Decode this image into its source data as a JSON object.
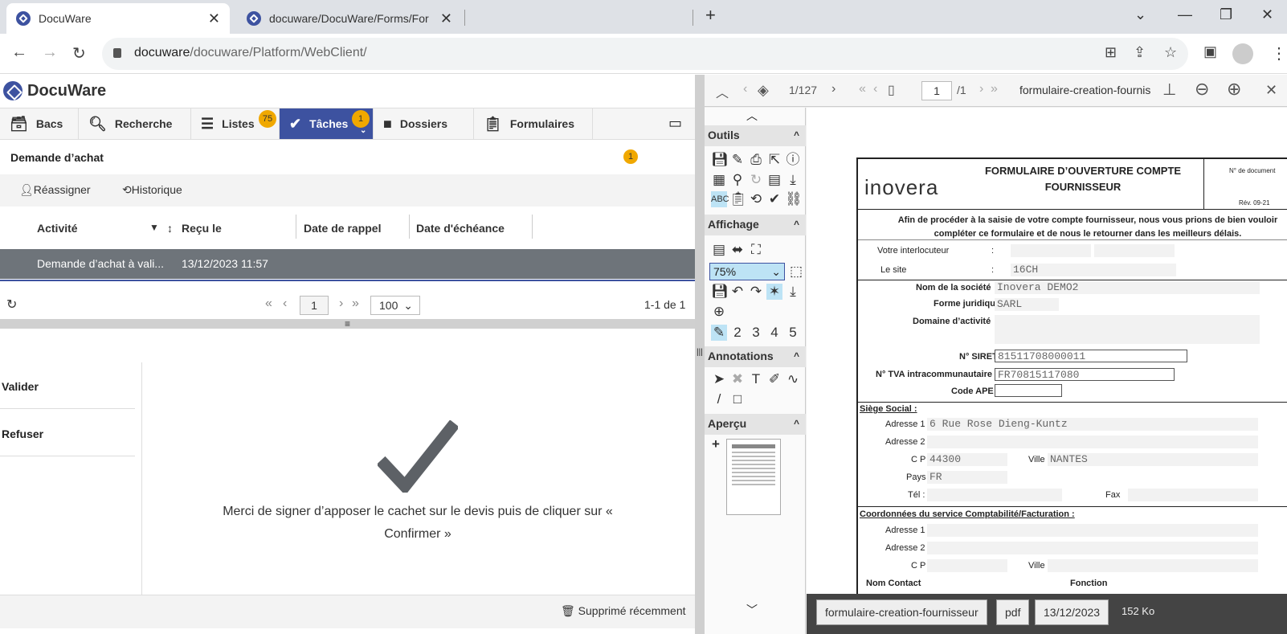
{
  "browser": {
    "tabs": [
      {
        "title": "DocuWare"
      },
      {
        "title": "docuware/DocuWare/Forms/For"
      }
    ],
    "url_host": "docuware",
    "url_path": "/docuware/Platform/WebClient/"
  },
  "app": {
    "logo": "DocuWare",
    "nav": [
      {
        "label": "Bacs"
      },
      {
        "label": "Recherche"
      },
      {
        "label": "Listes",
        "badge": "75"
      },
      {
        "label": "Tâches",
        "badge": "1"
      },
      {
        "label": "Dossiers"
      },
      {
        "label": "Formulaires"
      }
    ],
    "section_title": "Demande d’achat",
    "section_badge": "1",
    "actions": {
      "reassign": "Réassigner",
      "history": "Historique"
    },
    "columns": [
      "Activité",
      "Reçu le",
      "Date de rappel",
      "Date d'échéance"
    ],
    "row": {
      "activity": "Demande d’achat à vali...",
      "received": "13/12/2023 11:57"
    },
    "pager": {
      "page": "1",
      "size": "100",
      "count": "1-1 de 1"
    },
    "decisions": [
      "Valider",
      "Refuser"
    ],
    "message": "Merci de signer d’apposer le cachet sur le devis puis de cliquer sur « Confirmer »",
    "footer": "Supprimé récemment"
  },
  "viewer": {
    "doc_index": "1/127",
    "page": "1",
    "page_total": "/1",
    "doc_name": "formulaire-creation-fournis",
    "sections": {
      "tools": "Outils",
      "display": "Affichage",
      "annotations": "Annotations",
      "preview": "Aperçu"
    },
    "zoom": "75%",
    "layers": [
      "2",
      "3",
      "4",
      "5"
    ],
    "status": {
      "name": "formulaire-creation-fournisseur",
      "type": "pdf",
      "date": "13/12/2023",
      "size": "152 Ko"
    }
  },
  "form": {
    "logo": "inovera",
    "title": "FORMULAIRE D’OUVERTURE COMPTE FOURNISSEUR",
    "docno": "N° de document",
    "rev": "Rév. 09-21",
    "intro": "Afin de procéder à la saisie de votre compte fournisseur, nous vous prions de bien vouloir compléter ce formulaire et de nous le retourner dans les meilleurs délais.",
    "f_contact": "Votre interlocuteur",
    "f_site": "Le site",
    "v_site": "16CH",
    "colon1": ":",
    "colon2": ":",
    "f_company": "Nom de la société",
    "v_company": "Inovera DEMO2",
    "f_legal": "Forme juridique",
    "v_legal": "SARL",
    "f_domain": "Domaine d’activité",
    "f_siret": "N° SIRET",
    "v_siret": "81511708000011",
    "f_tva": "N° TVA intracommunautaire",
    "v_tva": "FR70815117080",
    "f_ape": "Code APE",
    "s_hq": "Siège Social :",
    "f_addr1": "Adresse 1",
    "v_addr1": "6 Rue Rose Dieng-Kuntz",
    "f_addr2": "Adresse 2",
    "f_cp": "C P",
    "v_cp": "44300",
    "f_city": "Ville",
    "v_city": "NANTES",
    "f_country": "Pays",
    "v_country": "FR",
    "f_tel": "Tél :",
    "f_fax": "Fax",
    "s_acc": "Coordonnées du service Comptabilité/Facturation :",
    "f_addr1b": "Adresse 1",
    "f_addr2b": "Adresse 2",
    "f_cpb": "C P",
    "f_cityb": "Ville",
    "f_contactname": "Nom Contact",
    "f_function": "Fonction"
  }
}
